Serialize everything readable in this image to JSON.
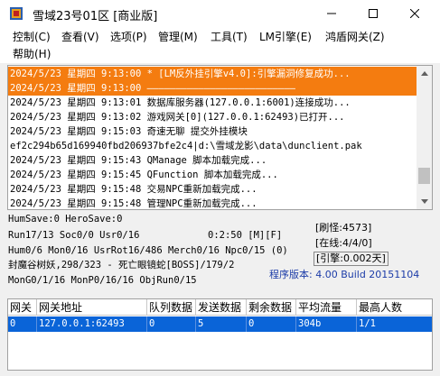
{
  "window": {
    "title": "雪域23号01区 [商业版]"
  },
  "menu": [
    {
      "label": "控制(C)"
    },
    {
      "label": "查看(V)"
    },
    {
      "label": "选项(P)"
    },
    {
      "label": "管理(M)"
    },
    {
      "label": "工具(T)"
    },
    {
      "label": "LM引擎(E)"
    },
    {
      "label": "鸿盾网关(Z)"
    },
    {
      "label": "帮助(H)"
    }
  ],
  "log": {
    "lines": [
      {
        "text": "2024/5/23 星期四 9:13:00 * [LM反外挂引擎v4.0]:引擎漏洞修复成功...",
        "highlight": true
      },
      {
        "text": "2024/5/23 星期四 9:13:00 ——————————————————————————",
        "highlight": true
      },
      {
        "text": "2024/5/23 星期四 9:13:01 数据库服务器(127.0.0.1:6001)连接成功...",
        "highlight": false
      },
      {
        "text": "2024/5/23 星期四 9:13:02 游戏网关[0](127.0.0.1:62493)已打开...",
        "highlight": false
      },
      {
        "text": "2024/5/23 星期四 9:15:03 奇速无聊 提交外挂模块",
        "highlight": false
      },
      {
        "text": "ef2c294b65d169940fbd206937bfe2c4|d:\\雪域龙影\\data\\dunclient.pak",
        "highlight": false
      },
      {
        "text": "2024/5/23 星期四 9:15:43 QManage 脚本加载完成...",
        "highlight": false
      },
      {
        "text": "2024/5/23 星期四 9:15:45 QFunction 脚本加载完成...",
        "highlight": false
      },
      {
        "text": "2024/5/23 星期四 9:15:48 交易NPC重新加载完成...",
        "highlight": false
      },
      {
        "text": "2024/5/23 星期四 9:15:48 管理NPC重新加载完成...",
        "highlight": false
      }
    ],
    "scroll_position": 0.9
  },
  "status": {
    "save": "HumSave:0 HeroSave:0",
    "run": "Run17/13 Soc0/0 Usr0/16",
    "clock": "0:2:50 [M][F]",
    "shuaguai": "[刷怪:4573]",
    "online": "[在线:4/4/0]",
    "hum": "Hum0/6 Mon0/16 UsrRot16/486 Merch0/16 Npc0/15 (0)",
    "fengmo": "封魔谷树妖,298/323 - 死亡眼镜蛇[BOSS]/179/2",
    "xingji": "[引擎:0.002天]",
    "mon": "MonG0/1/16 MonP0/16/16 ObjRun0/15",
    "version": "程序版本: 4.00 Build 20151104"
  },
  "table": {
    "headers": [
      "网关",
      "网关地址",
      "队列数据",
      "发送数据",
      "剩余数据",
      "平均流量",
      "最高人数"
    ],
    "rows": [
      [
        "0",
        "127.0.0.1:62493",
        "0",
        "5",
        "0",
        "304b",
        "1/1"
      ]
    ]
  },
  "colors": {
    "highlight": "#f47c10",
    "selected_row": "#0a64d8",
    "version_text": "#1c3ca8"
  },
  "icons": {
    "app": "app-icon",
    "minimize": "minimize-icon",
    "maximize": "maximize-icon",
    "close": "close-icon"
  }
}
